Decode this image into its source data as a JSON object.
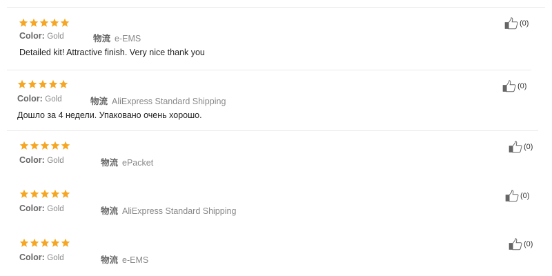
{
  "colors": {
    "star": "#f5a623",
    "divider": "#e8e8e8",
    "text": "#222222",
    "muted": "#888888"
  },
  "reviews": [
    {
      "rating": 5,
      "color_label": "Color:",
      "color_value": "Gold",
      "shipping_label": "物流",
      "shipping_value": "e-EMS",
      "text": "Detailed kit! Attractive finish. Very nice thank you",
      "helpful": "(0)"
    },
    {
      "rating": 5,
      "color_label": "Color:",
      "color_value": "Gold",
      "shipping_label": "物流",
      "shipping_value": "AliExpress Standard Shipping",
      "text": "Дошло за 4 недели. Упаковано очень хорошо.",
      "helpful": "(0)"
    },
    {
      "rating": 5,
      "color_label": "Color:",
      "color_value": "Gold",
      "shipping_label": "物流",
      "shipping_value": "ePacket",
      "text": "",
      "helpful": "(0)"
    },
    {
      "rating": 5,
      "color_label": "Color:",
      "color_value": "Gold",
      "shipping_label": "物流",
      "shipping_value": "AliExpress Standard Shipping",
      "text": "",
      "helpful": "(0)"
    },
    {
      "rating": 5,
      "color_label": "Color:",
      "color_value": "Gold",
      "shipping_label": "物流",
      "shipping_value": "e-EMS",
      "text": "",
      "helpful": "(0)"
    }
  ]
}
